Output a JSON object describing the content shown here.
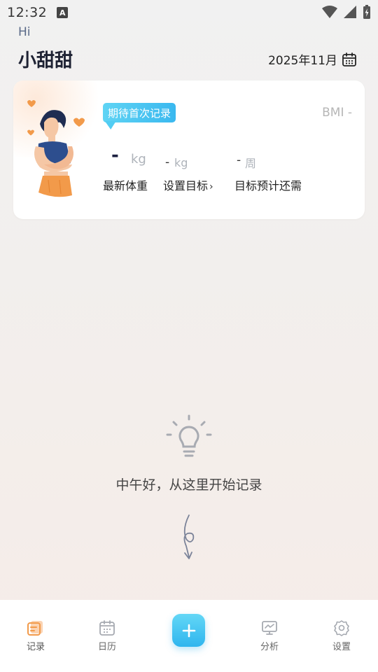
{
  "status_bar": {
    "time": "12:32",
    "badge": "A"
  },
  "header": {
    "greeting": "Hi",
    "user_name": "小甜甜",
    "month": "2025年11月"
  },
  "summary_card": {
    "badge_text": "期待首次记录",
    "bmi_text": "BMI -",
    "latest_weight_value": "-",
    "latest_weight_unit": "kg",
    "target_value": "-",
    "target_unit": "kg",
    "remaining_value": "-",
    "remaining_unit": "周",
    "labels": {
      "latest_weight": "最新体重",
      "set_target": "设置目标",
      "set_target_chevron": "›",
      "time_to_goal": "目标预计还需"
    }
  },
  "empty_state": {
    "message": "中午好，从这里开始记录"
  },
  "tab_bar": {
    "tabs": [
      {
        "label": "记录",
        "icon": "record-icon",
        "active": true
      },
      {
        "label": "日历",
        "icon": "calendar-icon",
        "active": false
      },
      {
        "label": "分析",
        "icon": "analysis-icon",
        "active": false
      },
      {
        "label": "设置",
        "icon": "settings-icon",
        "active": false
      }
    ],
    "add_symbol": "+"
  },
  "colors": {
    "accent": "#3ab8ef",
    "active_tab": "#f29a4a"
  }
}
